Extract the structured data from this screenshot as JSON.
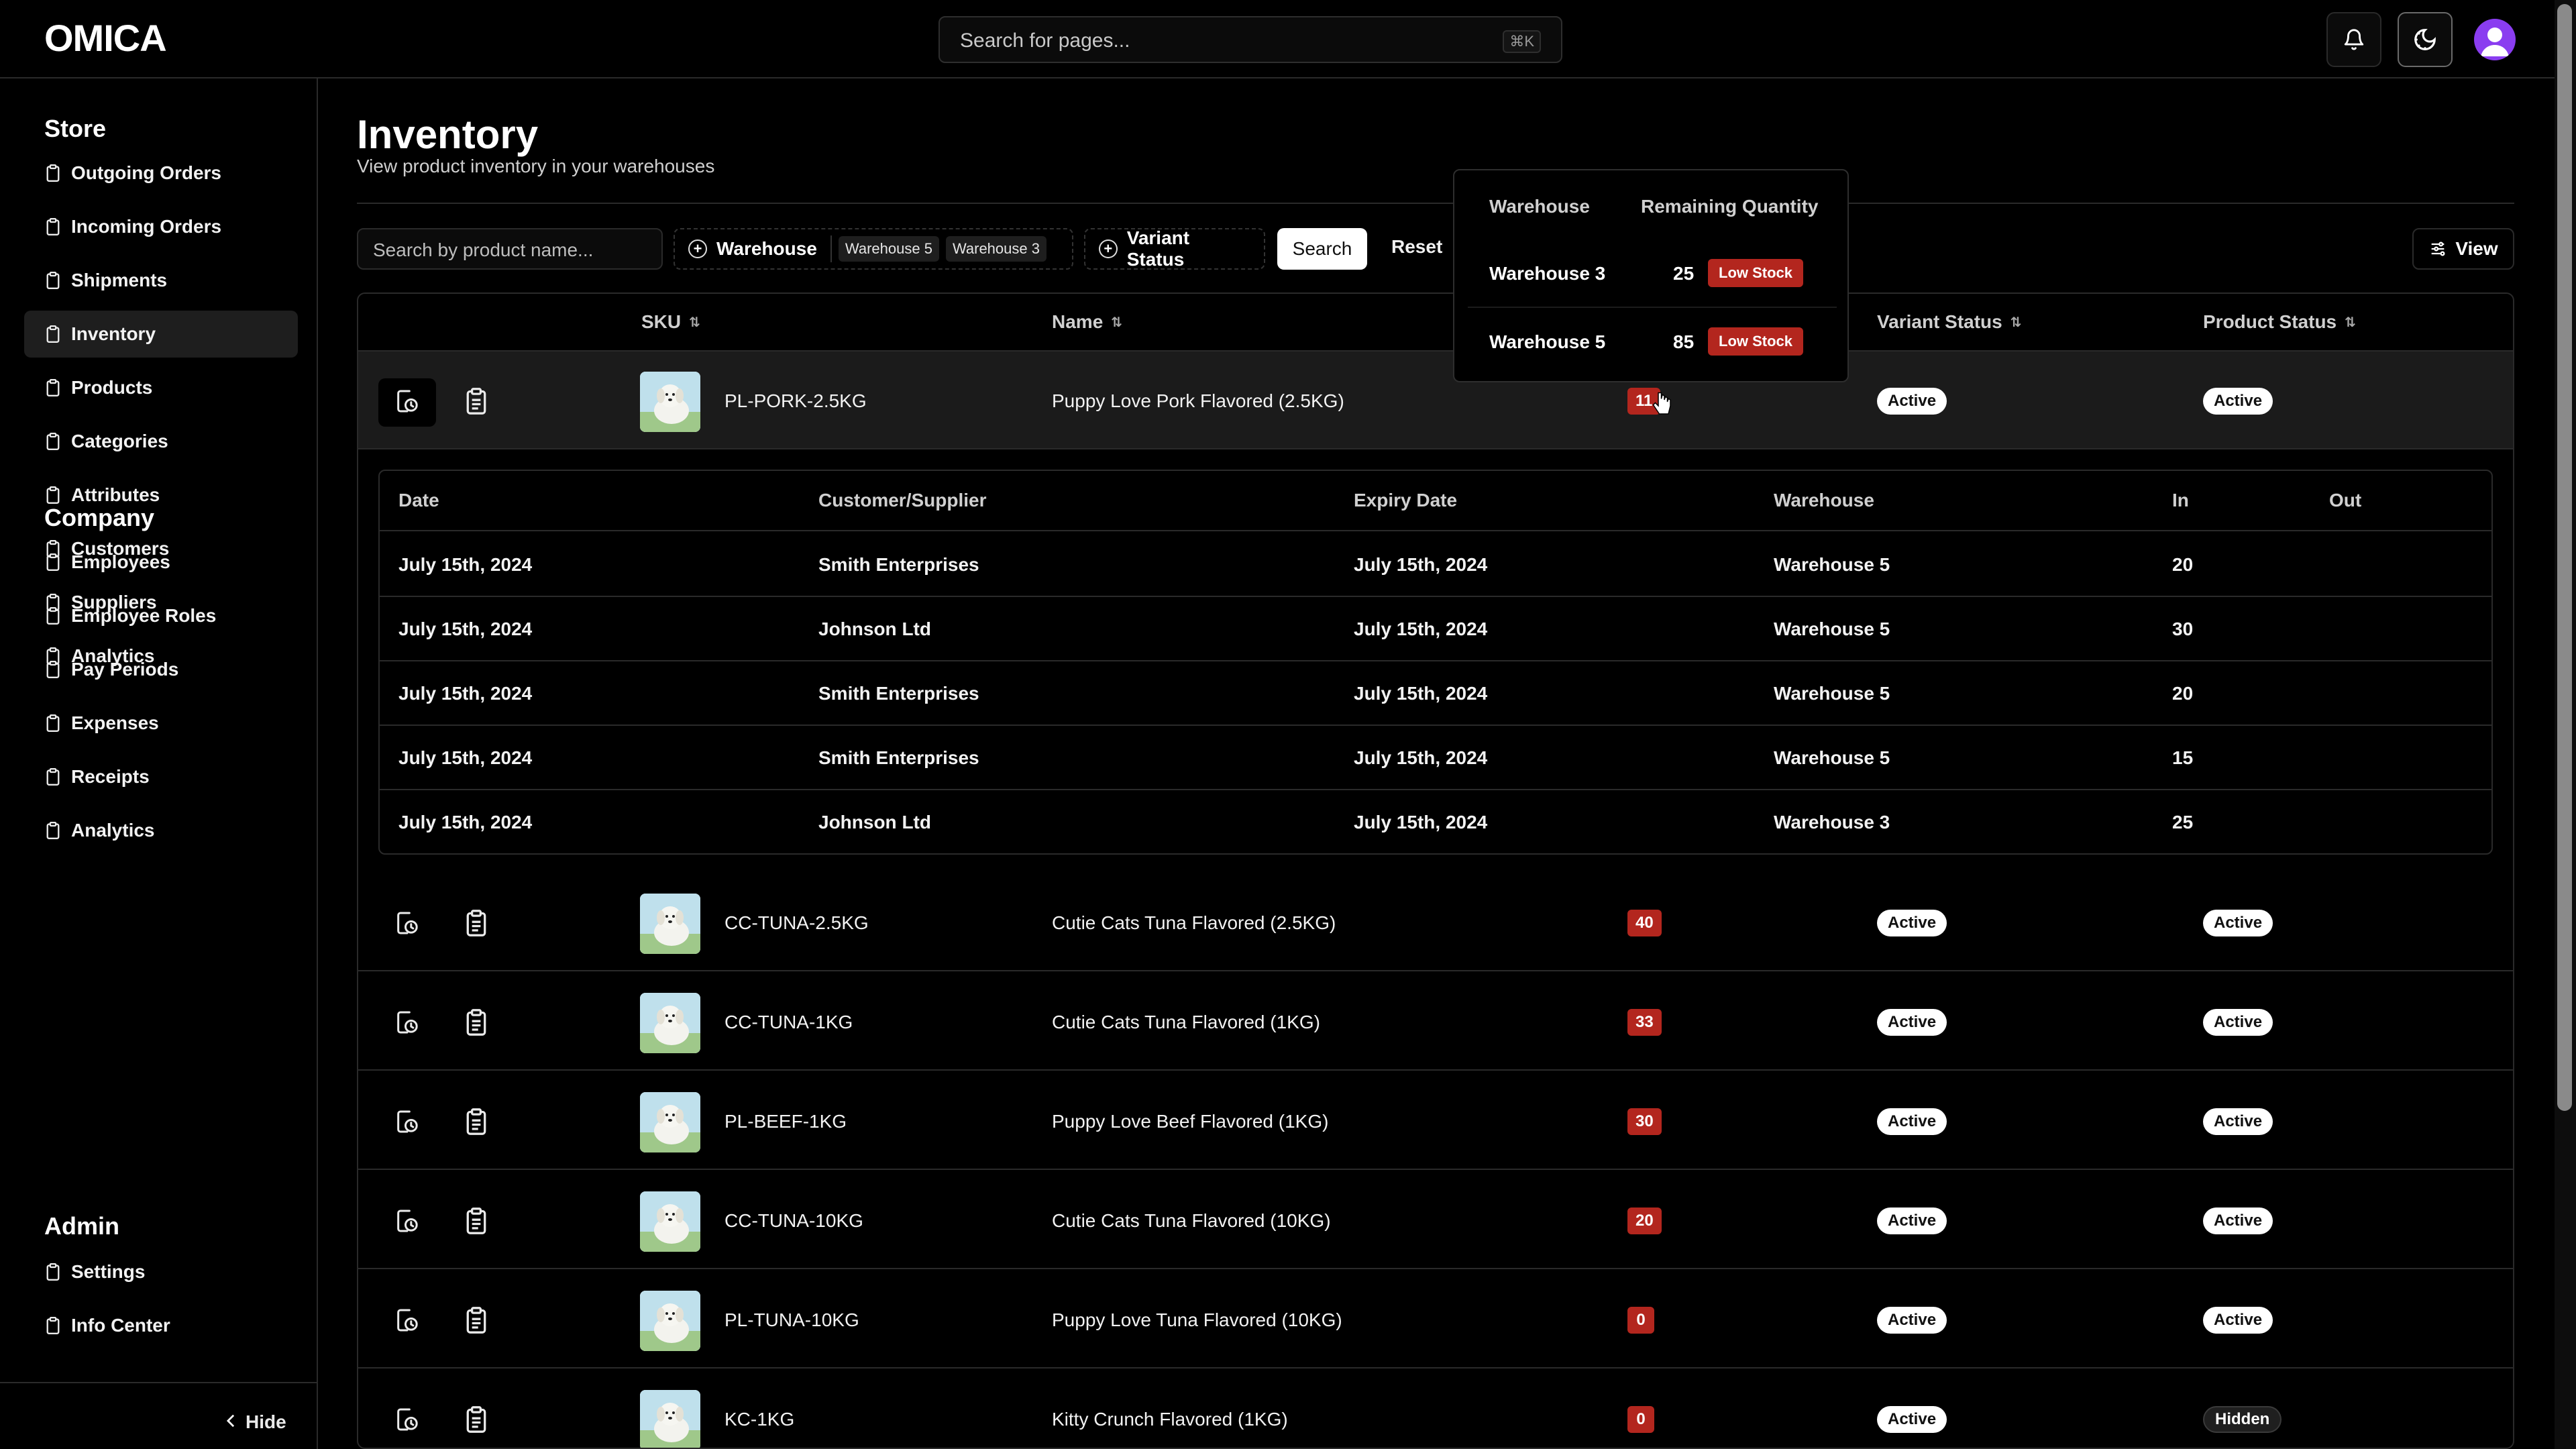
{
  "app": {
    "logo": "OMICA"
  },
  "topbar": {
    "search_placeholder": "Search for pages...",
    "shortcut": "⌘K"
  },
  "sidebar": {
    "store_title": "Store",
    "store_items": [
      "Outgoing Orders",
      "Incoming Orders",
      "Shipments",
      "Inventory",
      "Products",
      "Categories",
      "Attributes",
      "Customers",
      "Suppliers",
      "Analytics"
    ],
    "active_item": "Inventory",
    "company_title": "Company",
    "company_items": [
      "Employees",
      "Employee Roles",
      "Pay Periods",
      "Expenses",
      "Receipts",
      "Analytics"
    ],
    "admin_title": "Admin",
    "admin_items": [
      "Settings",
      "Info Center"
    ],
    "hide_label": "Hide"
  },
  "page": {
    "title": "Inventory",
    "subtitle": "View product inventory in your warehouses"
  },
  "filters": {
    "search_placeholder": "Search by product name...",
    "warehouse_label": "Warehouse",
    "warehouse_tags": [
      "Warehouse 5",
      "Warehouse 3"
    ],
    "variant_status_label": "Variant Status",
    "search_button": "Search",
    "reset_button": "Reset",
    "view_button": "View"
  },
  "table": {
    "columns": {
      "sku": "SKU",
      "name": "Name",
      "variant_status": "Variant Status",
      "product_status": "Product Status"
    },
    "rows": [
      {
        "sku": "PL-PORK-2.5KG",
        "name": "Puppy Love Pork Flavored (2.5KG)",
        "qty": "11",
        "variant_status": "Active",
        "product_status": "Active"
      },
      {
        "sku": "CC-TUNA-2.5KG",
        "name": "Cutie Cats Tuna Flavored (2.5KG)",
        "qty": "40",
        "variant_status": "Active",
        "product_status": "Active"
      },
      {
        "sku": "CC-TUNA-1KG",
        "name": "Cutie Cats Tuna Flavored (1KG)",
        "qty": "33",
        "variant_status": "Active",
        "product_status": "Active"
      },
      {
        "sku": "PL-BEEF-1KG",
        "name": "Puppy Love Beef Flavored (1KG)",
        "qty": "30",
        "variant_status": "Active",
        "product_status": "Active"
      },
      {
        "sku": "CC-TUNA-10KG",
        "name": "Cutie Cats Tuna Flavored (10KG)",
        "qty": "20",
        "variant_status": "Active",
        "product_status": "Active"
      },
      {
        "sku": "PL-TUNA-10KG",
        "name": "Puppy Love Tuna Flavored (10KG)",
        "qty": "0",
        "variant_status": "Active",
        "product_status": "Active"
      },
      {
        "sku": "KC-1KG",
        "name": "Kitty Crunch Flavored (1KG)",
        "qty": "0",
        "variant_status": "Active",
        "product_status": "Hidden"
      }
    ]
  },
  "detail": {
    "columns": {
      "date": "Date",
      "party": "Customer/Supplier",
      "expiry": "Expiry Date",
      "warehouse": "Warehouse",
      "in": "In",
      "out": "Out"
    },
    "rows": [
      {
        "date": "July 15th, 2024",
        "party": "Smith Enterprises",
        "expiry": "July 15th, 2024",
        "warehouse": "Warehouse 5",
        "in": "20",
        "out": ""
      },
      {
        "date": "July 15th, 2024",
        "party": "Johnson Ltd",
        "expiry": "July 15th, 2024",
        "warehouse": "Warehouse 5",
        "in": "30",
        "out": ""
      },
      {
        "date": "July 15th, 2024",
        "party": "Smith Enterprises",
        "expiry": "July 15th, 2024",
        "warehouse": "Warehouse 5",
        "in": "20",
        "out": ""
      },
      {
        "date": "July 15th, 2024",
        "party": "Smith Enterprises",
        "expiry": "July 15th, 2024",
        "warehouse": "Warehouse 5",
        "in": "15",
        "out": ""
      },
      {
        "date": "July 15th, 2024",
        "party": "Johnson Ltd",
        "expiry": "July 15th, 2024",
        "warehouse": "Warehouse 3",
        "in": "25",
        "out": ""
      }
    ]
  },
  "popover": {
    "col_warehouse": "Warehouse",
    "col_remaining": "Remaining Quantity",
    "rows": [
      {
        "warehouse": "Warehouse 3",
        "qty": "25",
        "badge": "Low Stock"
      },
      {
        "warehouse": "Warehouse 5",
        "qty": "85",
        "badge": "Low Stock"
      }
    ]
  },
  "colors": {
    "low_stock": "#b3261e",
    "avatar": "#8a3df0"
  }
}
